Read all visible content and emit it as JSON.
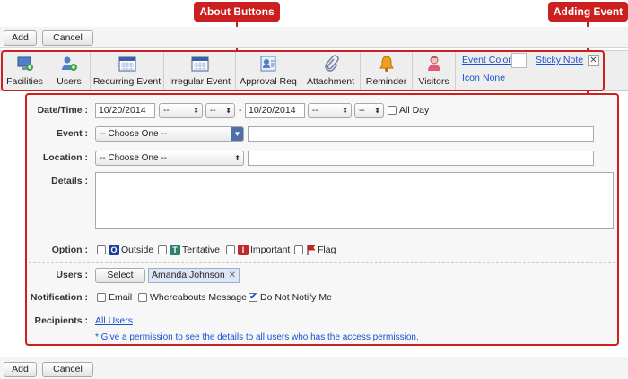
{
  "top_actions": {
    "add_label": "Add",
    "cancel_label": "Cancel"
  },
  "bottom_actions": {
    "add_label": "Add",
    "cancel_label": "Cancel"
  },
  "callouts": {
    "about_buttons": "About Buttons",
    "adding_event": "Adding Event"
  },
  "toolbar": {
    "facilities": "Facilities",
    "users": "Users",
    "recurring_event": "Recurring Event",
    "irregular_event": "Irregular Event",
    "approval_req": "Approval Req",
    "attachment": "Attachment",
    "reminder": "Reminder",
    "visitors": "Visitors",
    "event_color": "Event Color",
    "sticky_note": "Sticky Note",
    "icon": "Icon",
    "icon_value": "None"
  },
  "form": {
    "datetime": {
      "label": "Date/Time :",
      "start_date": "10/20/2014",
      "start_hour": "--",
      "start_min": "--",
      "separator": "-",
      "end_date": "10/20/2014",
      "end_hour": "--",
      "end_min": "--",
      "all_day": "All Day"
    },
    "event": {
      "label": "Event :",
      "selected": "-- Choose One --",
      "text": ""
    },
    "location": {
      "label": "Location :",
      "selected": "-- Choose One --",
      "text": ""
    },
    "details": {
      "label": "Details :",
      "text": ""
    },
    "option": {
      "label": "Option :",
      "outside_letter": "O",
      "outside": "Outside",
      "tentative_letter": "T",
      "tentative": "Tentative",
      "important_letter": "I",
      "important": "Important",
      "flag": "Flag"
    },
    "users": {
      "label": "Users :",
      "select_label": "Select",
      "selected_user": "Amanda Johnson"
    },
    "notification": {
      "label": "Notification :",
      "email": "Email",
      "whereabouts": "Whereabouts Message",
      "do_not_notify": "Do Not Notify Me",
      "do_not_notify_checked": true
    },
    "recipients": {
      "label": "Recipients :",
      "value": "All Users",
      "note": "* Give a permission to see the details to all users who has the access permission."
    }
  },
  "colors": {
    "callout": "#cc1f1f",
    "link": "#1a4fcf",
    "outside": "#1f3f9f",
    "tentative": "#2f7f6f",
    "important": "#c0282a"
  }
}
